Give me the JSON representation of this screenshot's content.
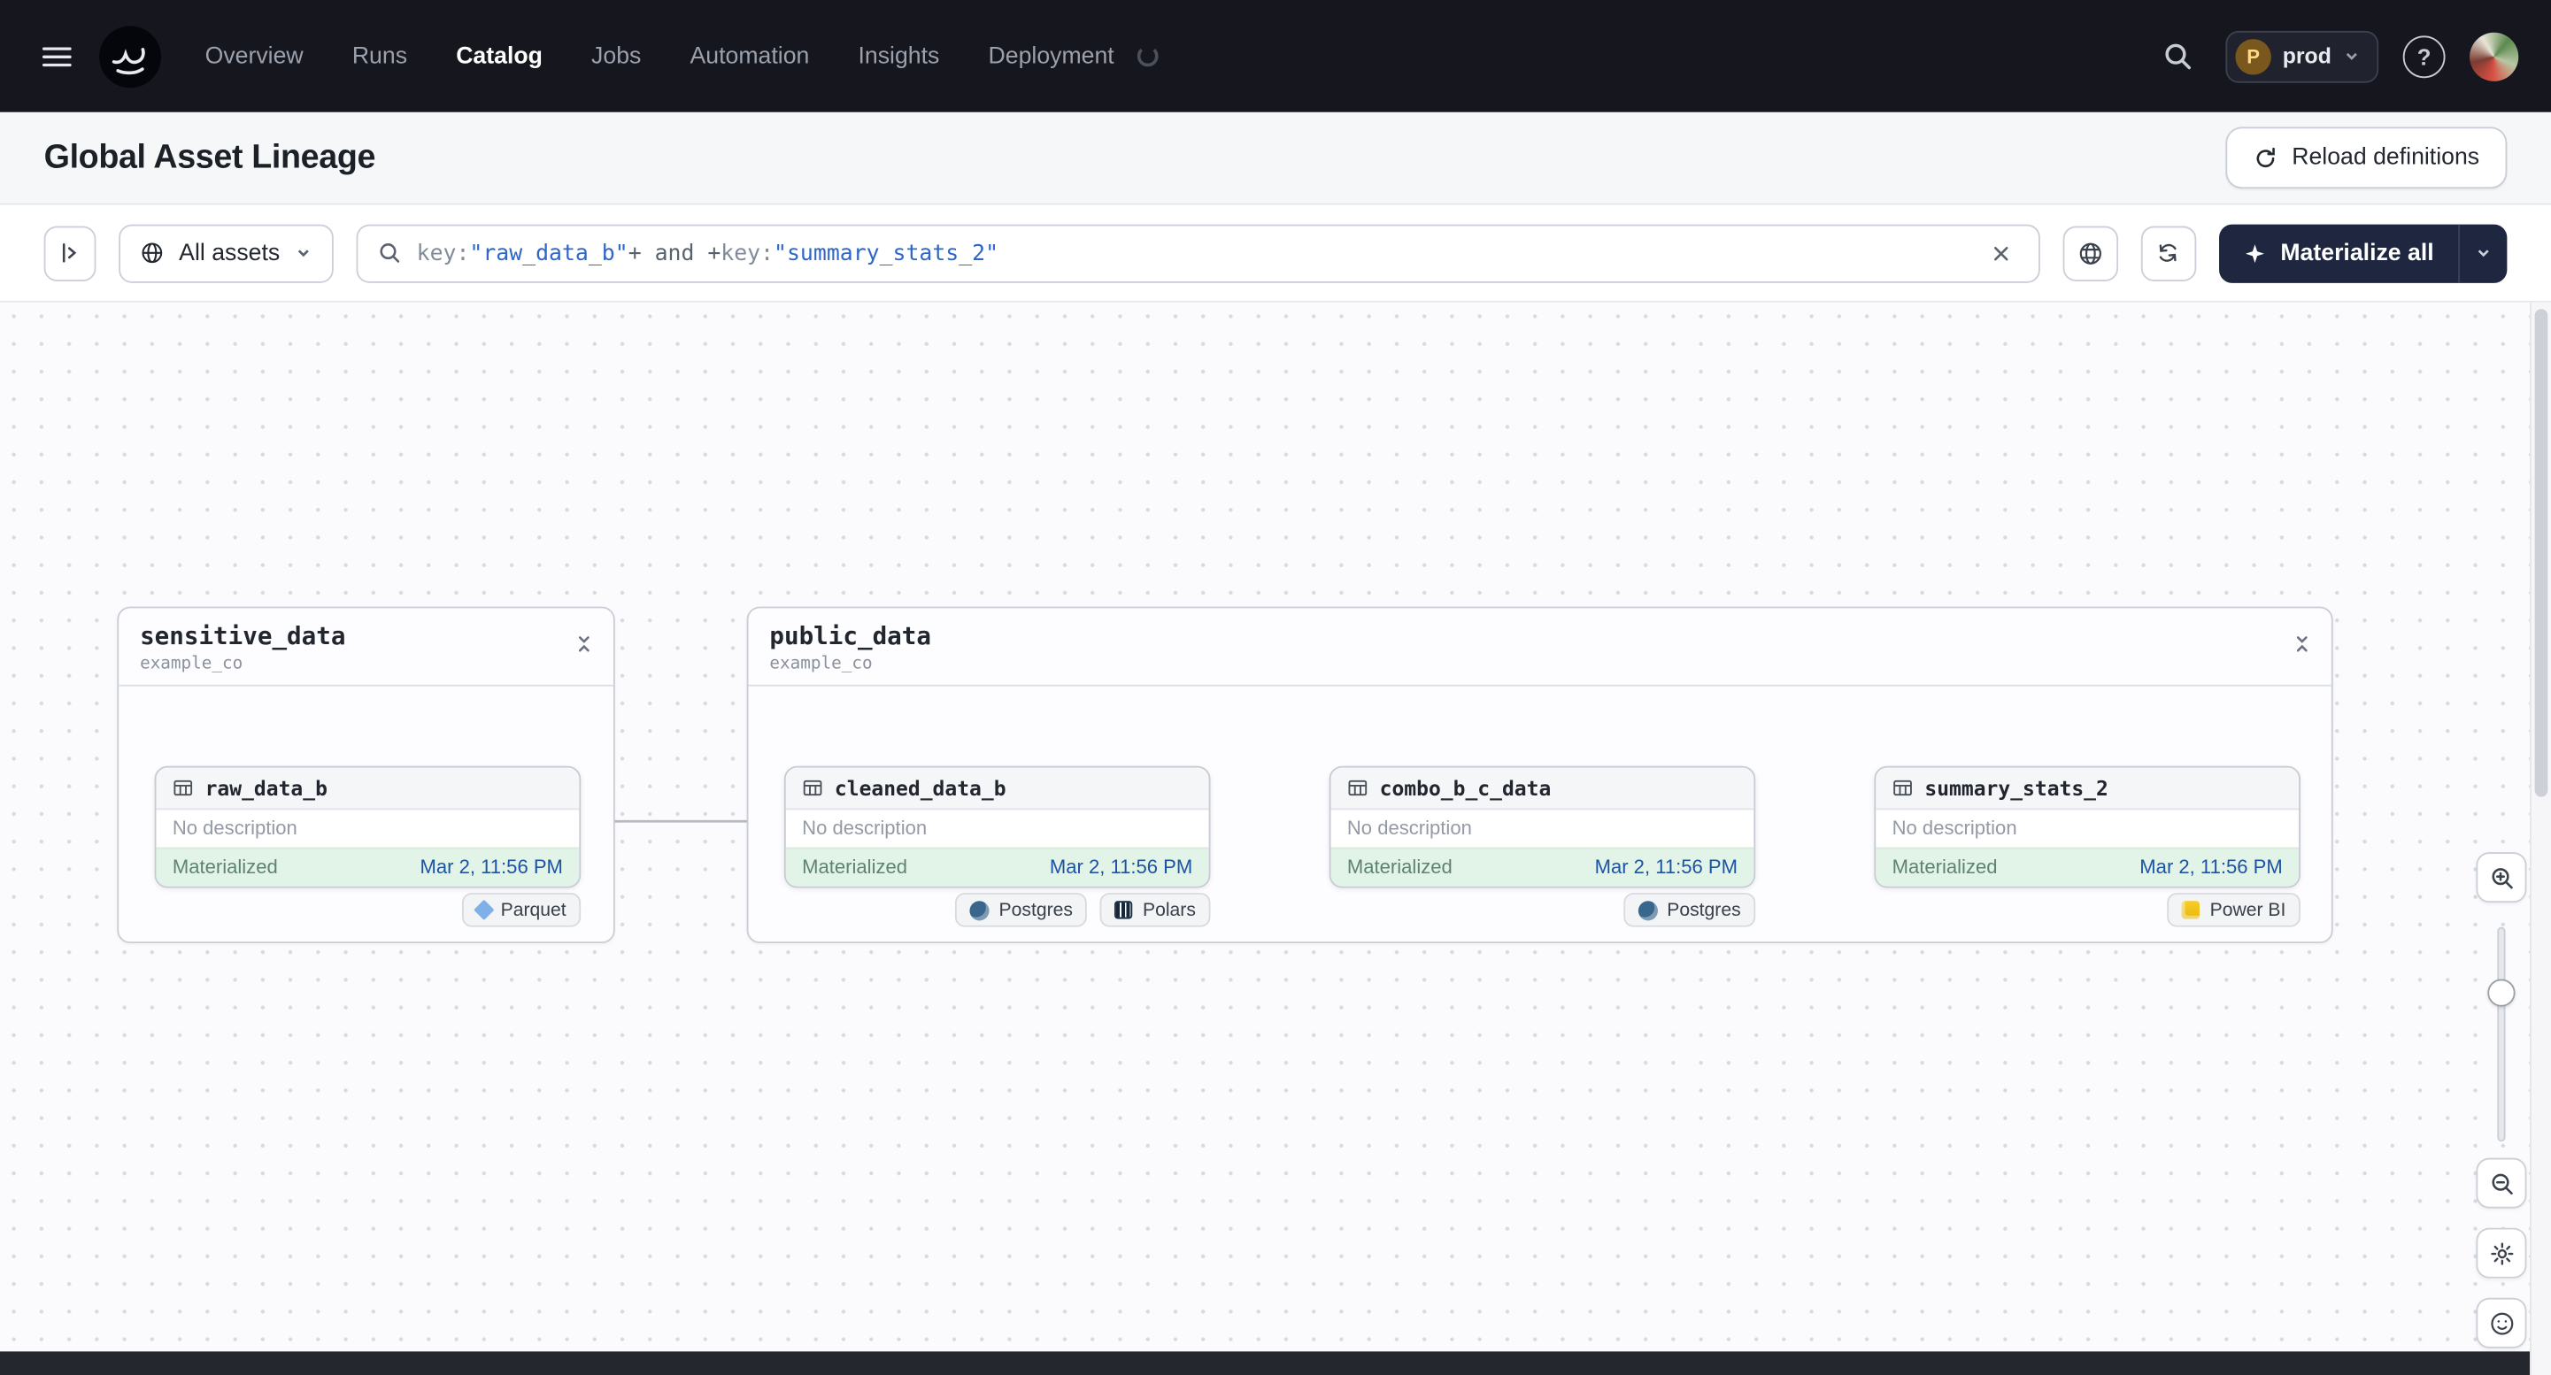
{
  "navbar": {
    "links": [
      "Overview",
      "Runs",
      "Catalog",
      "Jobs",
      "Automation",
      "Insights",
      "Deployment"
    ],
    "active_link": "Catalog",
    "env_badge": {
      "initial": "P",
      "label": "prod"
    }
  },
  "page_header": {
    "title": "Global Asset Lineage",
    "reload_button": "Reload definitions"
  },
  "toolbar": {
    "asset_filter": "All assets",
    "search_tokens": [
      {
        "text": "key:",
        "type": "key"
      },
      {
        "text": "\"raw_data_b\"",
        "type": "string"
      },
      {
        "text": "+ and +",
        "type": "operator"
      },
      {
        "text": "key:",
        "type": "key"
      },
      {
        "text": "\"summary_stats_2\"",
        "type": "string"
      }
    ],
    "materialize_button": "Materialize all"
  },
  "graph": {
    "groups": [
      {
        "title": "sensitive_data",
        "subtitle": "example_co",
        "assets": [
          {
            "name": "raw_data_b",
            "description": "No description",
            "status": "Materialized",
            "timestamp": "Mar 2, 11:56 PM",
            "tags": [
              {
                "label": "Parquet",
                "icon": "parquet-icon"
              }
            ]
          }
        ]
      },
      {
        "title": "public_data",
        "subtitle": "example_co",
        "assets": [
          {
            "name": "cleaned_data_b",
            "description": "No description",
            "status": "Materialized",
            "timestamp": "Mar 2, 11:56 PM",
            "tags": [
              {
                "label": "Postgres",
                "icon": "postgres-icon"
              },
              {
                "label": "Polars",
                "icon": "polars-icon"
              }
            ]
          },
          {
            "name": "combo_b_c_data",
            "description": "No description",
            "status": "Materialized",
            "timestamp": "Mar 2, 11:56 PM",
            "tags": [
              {
                "label": "Postgres",
                "icon": "postgres-icon"
              }
            ]
          },
          {
            "name": "summary_stats_2",
            "description": "No description",
            "status": "Materialized",
            "timestamp": "Mar 2, 11:56 PM",
            "tags": [
              {
                "label": "Power BI",
                "icon": "powerbi-icon"
              }
            ]
          }
        ]
      }
    ]
  },
  "colors": {
    "navbar_bg": "#15161E",
    "accent_blue": "#2E66C9",
    "status_green_bg": "#E2F4E7",
    "materialize_bg": "#1F2740"
  }
}
